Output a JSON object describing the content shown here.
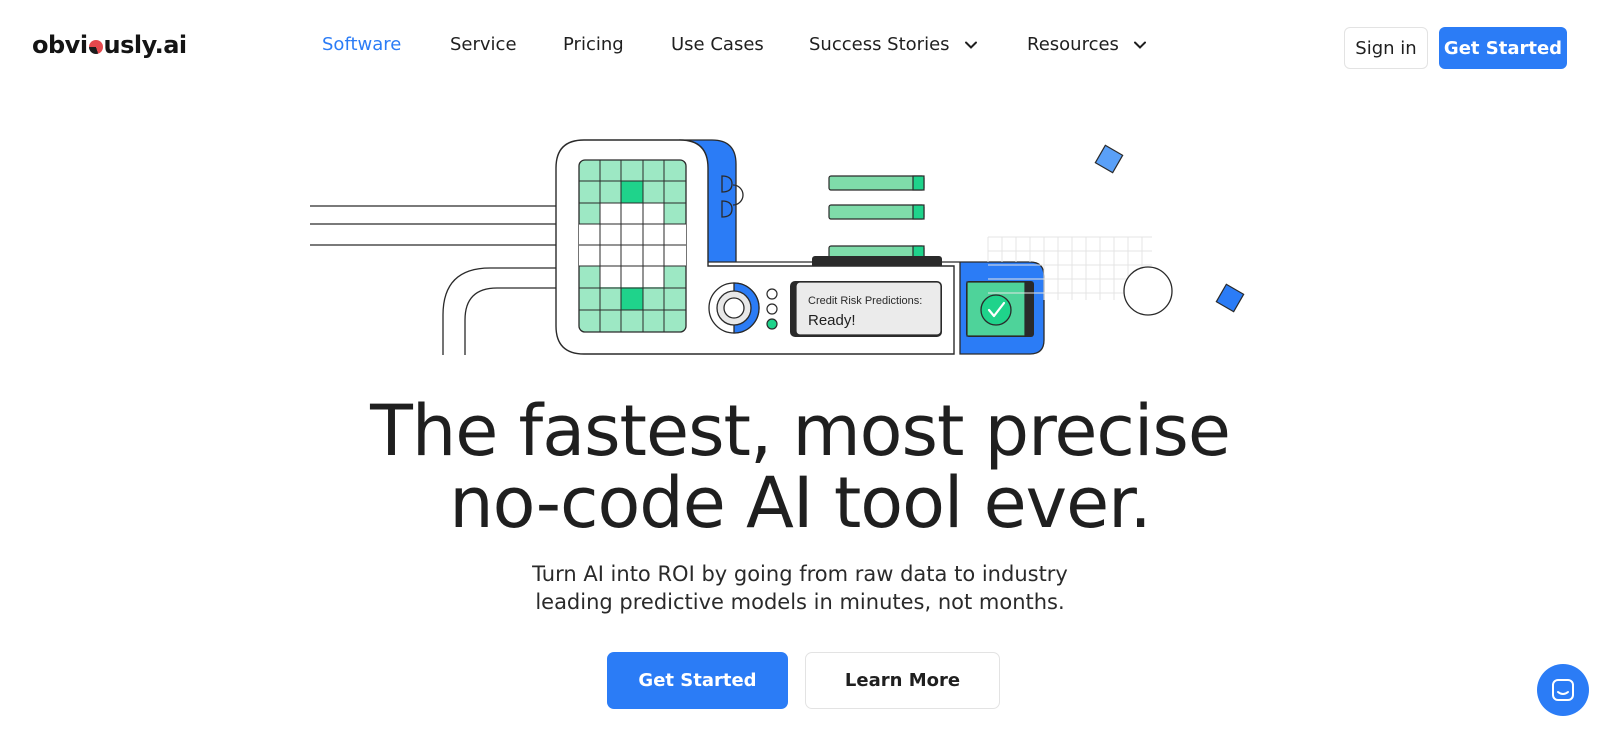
{
  "brand": {
    "logo_text_a": "obvi",
    "logo_text_b": "usly.ai",
    "primary_color": "#2b7cf6",
    "accent_green": "#1fd38b",
    "light_green": "#9de8c4"
  },
  "nav": {
    "links": [
      {
        "label": "Software",
        "active": true
      },
      {
        "label": "Service"
      },
      {
        "label": "Pricing"
      },
      {
        "label": "Use Cases"
      },
      {
        "label": "Success Stories",
        "has_dropdown": true,
        "icon": "chevron-down-icon"
      },
      {
        "label": "Resources",
        "has_dropdown": true,
        "icon": "chevron-down-icon"
      }
    ],
    "sign_in_label": "Sign in",
    "get_started_label": "Get Started"
  },
  "illustration": {
    "screen_label": "Credit Risk Predictions:",
    "screen_status": "Ready!",
    "status_icon": "check-icon"
  },
  "hero": {
    "headline_line1": "The fastest, most precise",
    "headline_line2": "no-code AI tool ever.",
    "subtext_line1": "Turn AI into ROI by going from raw data to industry",
    "subtext_line2": "leading predictive models in minutes, not months.",
    "primary_cta": "Get Started",
    "secondary_cta": "Learn More"
  },
  "chat": {
    "icon": "chat-icon"
  }
}
